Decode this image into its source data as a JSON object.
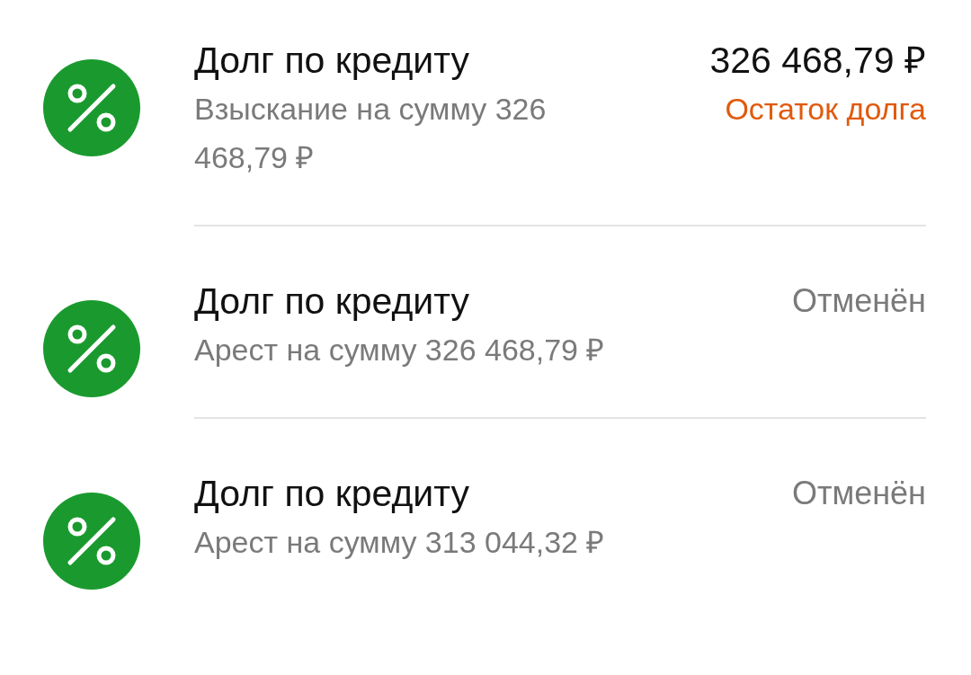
{
  "operations": [
    {
      "title": "Долг по кредиту",
      "subtitle": "Взыскание на сумму 326 468,79 ₽",
      "amount": "326 468,79 ₽",
      "status": {
        "text": "Остаток долга",
        "color": "#e05a0c"
      }
    },
    {
      "title": "Долг по кредиту",
      "subtitle": "Арест на сумму 326 468,79 ₽",
      "status": {
        "text": "Отменён",
        "color": "#7a7a7a"
      }
    },
    {
      "title": "Долг по кредиту",
      "subtitle": "Арест на сумму 313 044,32 ₽",
      "status": {
        "text": "Отменён",
        "color": "#7a7a7a"
      }
    }
  ]
}
